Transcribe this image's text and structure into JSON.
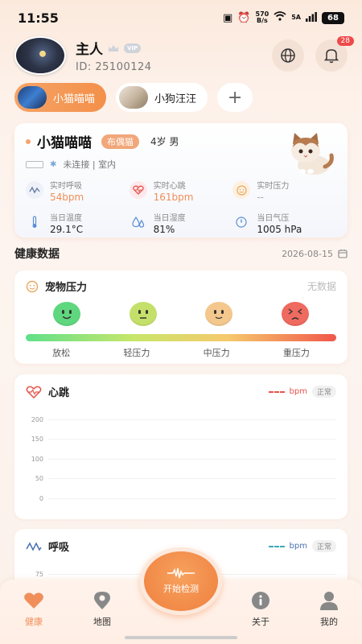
{
  "status_bar": {
    "time": "11:55",
    "netspeed_value": "570",
    "netspeed_unit": "B/s",
    "signal_label": "5A",
    "battery": "68"
  },
  "user": {
    "name": "主人",
    "id_label": "ID:",
    "id_value": "25100124",
    "notification_count": "28"
  },
  "pet_tabs": [
    {
      "label": "小猫喵喵",
      "active": true
    },
    {
      "label": "小狗汪汪",
      "active": false
    }
  ],
  "add_tab_symbol": "+",
  "pet": {
    "name": "小猫喵喵",
    "breed": "布偶猫",
    "age_gender": "4岁  男",
    "connection": "未连接 | 室内",
    "metrics": [
      {
        "label": "实时呼吸",
        "value": "54bpm",
        "icon": "breath-icon"
      },
      {
        "label": "实时心跳",
        "value": "161bpm",
        "icon": "heart-icon"
      },
      {
        "label": "实时压力",
        "value": "--",
        "icon": "smile-icon"
      },
      {
        "label": "当日温度",
        "value": "29.1°C",
        "icon": "thermometer-icon"
      },
      {
        "label": "当日湿度",
        "value": "81%",
        "icon": "humidity-icon"
      },
      {
        "label": "当日气压",
        "value": "1005 hPa",
        "icon": "pressure-icon"
      }
    ]
  },
  "health": {
    "title": "健康数据",
    "date": "2026-08-15"
  },
  "stress_card": {
    "title": "宠物压力",
    "status": "无数据",
    "levels": [
      "放松",
      "轻压力",
      "中压力",
      "重压力"
    ]
  },
  "heart_card": {
    "title": "心跳",
    "unit": "bpm",
    "status": "正常",
    "y_ticks": [
      "200",
      "150",
      "100",
      "50",
      "0"
    ]
  },
  "breath_card": {
    "title": "呼吸",
    "unit": "bpm",
    "status": "正常",
    "y_ticks": [
      "75"
    ]
  },
  "start_button": {
    "label": "开始检测"
  },
  "nav": [
    {
      "label": "健康",
      "active": true
    },
    {
      "label": "地图",
      "active": false
    },
    {
      "label": "关于",
      "active": false
    },
    {
      "label": "我的",
      "active": false
    }
  ],
  "colors": {
    "accent": "#f08f5a",
    "heart": "#e5534b",
    "breath": "#3aa9b8"
  }
}
